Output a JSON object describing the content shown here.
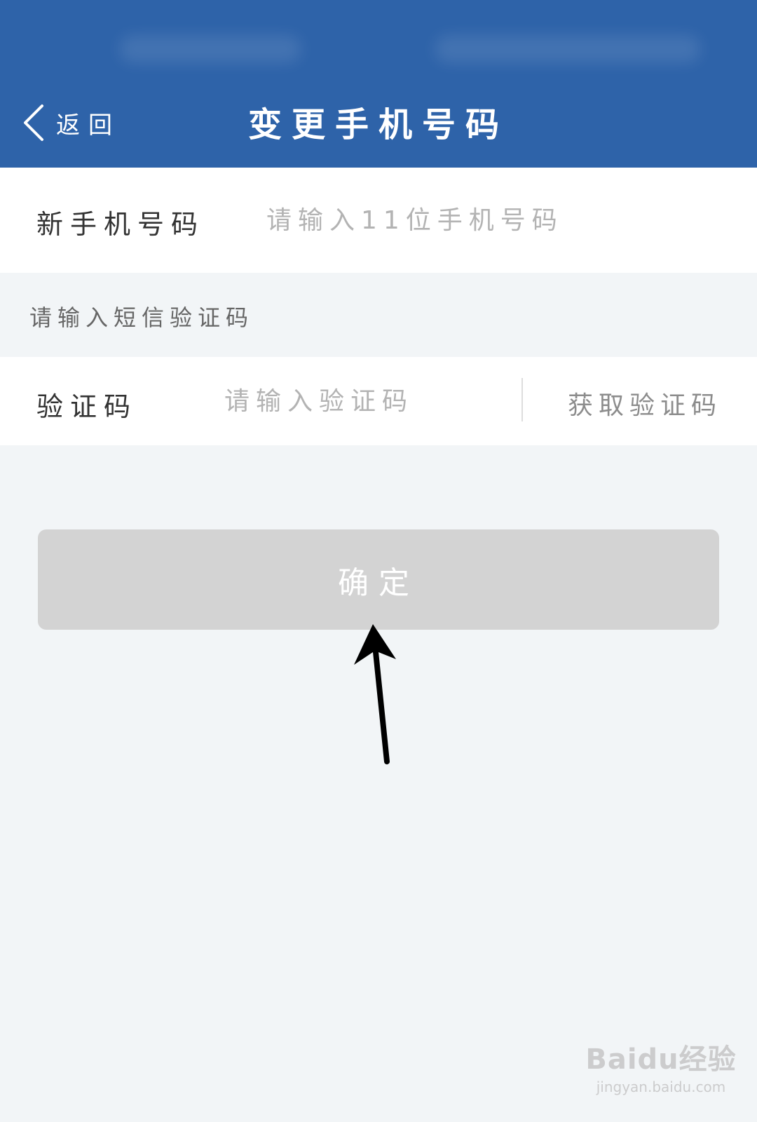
{
  "header": {
    "back_label": "返回",
    "title": "变更手机号码"
  },
  "phone_row": {
    "label": "新手机号码",
    "placeholder": "请输入11位手机号码"
  },
  "sms_hint": "请输入短信验证码",
  "code_row": {
    "label": "验证码",
    "placeholder": "请输入验证码",
    "get_code_label": "获取验证码"
  },
  "confirm_label": "确定",
  "watermark": {
    "brand": "Baidu经验",
    "url": "jingyan.baidu.com"
  },
  "colors": {
    "header_bg": "#2e63a9",
    "page_bg": "#f2f5f7",
    "button_disabled": "#d3d3d3"
  },
  "icons": {
    "back": "chevron-left-icon",
    "annotation": "arrow-up-icon"
  }
}
